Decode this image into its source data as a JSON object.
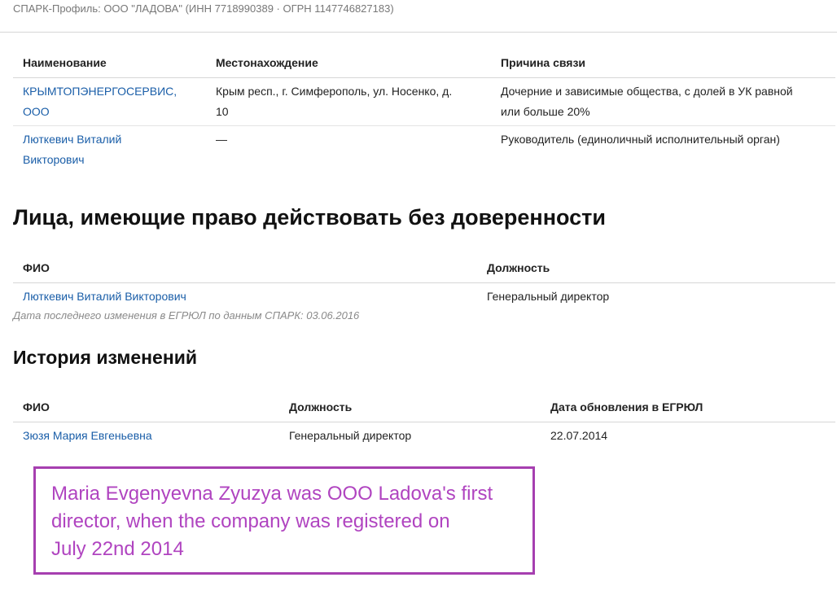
{
  "header": {
    "title": "СПАРК-Профиль: ООО \"ЛАДОВА\" (ИНН 7718990389 · ОГРН 1147746827183)"
  },
  "related": {
    "columns": [
      "Наименование",
      "Местонахождение",
      "Причина связи"
    ],
    "rows": [
      {
        "name_line1": "КРЫМТОПЭНЕРГОСЕРВИС,",
        "name_line2": "ООО",
        "location_line1": "Крым респ., г. Симферополь, ул. Носенко, д.",
        "location_line2": "10",
        "reason_line1": "Дочерние и зависимые общества, с долей в УК равной",
        "reason_line2": "или больше 20%"
      },
      {
        "name_line1": "Люткевич Виталий",
        "name_line2": "Викторович",
        "location_line1": "—",
        "reason_line1": "Руководитель (единоличный исполнительный орган)"
      }
    ]
  },
  "authorized": {
    "heading": "Лица, имеющие право действовать без доверенности",
    "columns": [
      "ФИО",
      "Должность"
    ],
    "rows": [
      {
        "name": "Люткевич Виталий Викторович",
        "position": "Генеральный директор"
      }
    ],
    "note": "Дата последнего изменения в ЕГРЮЛ по данным СПАРК: 03.06.2016"
  },
  "history": {
    "heading": "История изменений",
    "columns": [
      "ФИО",
      "Должность",
      "Дата обновления в ЕГРЮЛ"
    ],
    "rows": [
      {
        "name": "Зюзя Мария Евгеньевна",
        "position": "Генеральный директор",
        "date": "22.07.2014"
      }
    ]
  },
  "annotation": {
    "line1": "Maria Evgenyevna Zyuzya was OOO Ladova's first",
    "line2": "director, when the company was registered on",
    "line3": "July 22nd 2014"
  },
  "colors": {
    "link": "#1a5ea8",
    "annotation": "#b044c0",
    "annotation_border": "#a63fb0"
  }
}
